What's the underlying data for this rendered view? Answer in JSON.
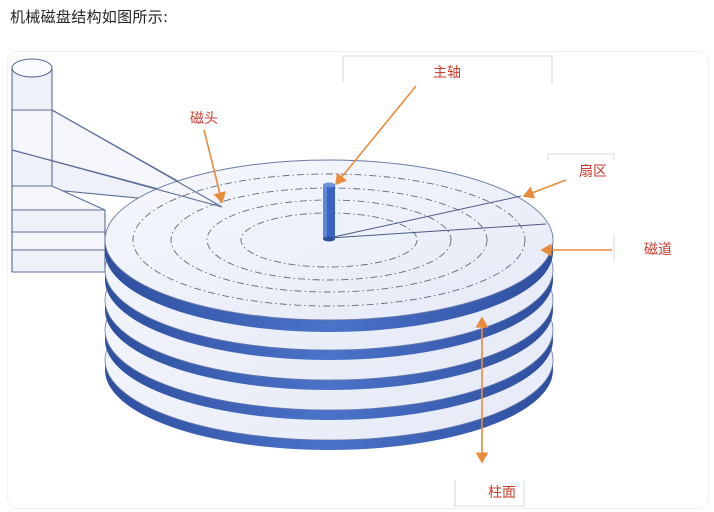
{
  "caption": "机械磁盘结构如图所示:",
  "labels": {
    "spindle": "主轴",
    "head": "磁头",
    "sector": "扇区",
    "track": "磁道",
    "cylinder": "柱面"
  },
  "colors": {
    "label_text": "#cc3a2b",
    "arrow": "#e98c3c",
    "platter_edge": "#3b5fb0",
    "platter_face": "#eef1fa",
    "spindle": "#3a64c1",
    "outline": "#5b6e99"
  }
}
